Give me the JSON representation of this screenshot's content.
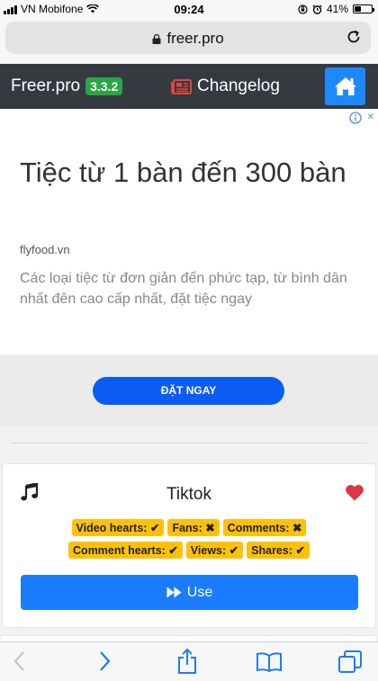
{
  "status_bar": {
    "carrier": "VN Mobifone",
    "time": "09:24",
    "battery": "41%",
    "battery_level": 0.41
  },
  "browser": {
    "url": "freer.pro"
  },
  "navbar": {
    "brand": "Freer.pro",
    "version": "3.3.2",
    "changelog": "Changelog"
  },
  "ad": {
    "title": "Tiệc từ 1 bàn đến 300 bàn",
    "domain": "flyfood.vn",
    "description": "Các loại tiệc từ đơn giản đến phức tạp, từ bình dân nhất đên cao cấp nhất, đặt tiệc ngay",
    "cta": "ĐẶT NGAY"
  },
  "card": {
    "title": "Tiktok",
    "badges_row1": [
      {
        "label": "Video hearts:",
        "status": "✔"
      },
      {
        "label": "Fans:",
        "status": "✖"
      },
      {
        "label": "Comments:",
        "status": "✖"
      }
    ],
    "badges_row2": [
      {
        "label": "Comment hearts:",
        "status": "✔"
      },
      {
        "label": "Views:",
        "status": "✔"
      },
      {
        "label": "Shares:",
        "status": "✔"
      }
    ],
    "use_label": "Use"
  },
  "colors": {
    "navbar_bg": "#343a40",
    "version_badge": "#28a745",
    "home_button": "#1e88ff",
    "changelog_icon": "#e0443e",
    "heart": "#dc3545",
    "badge": "#ffc107",
    "use_button": "#1a7dff",
    "ad_cta": "#0a5cf5",
    "toolbar_icon": "#1e7cf2"
  }
}
